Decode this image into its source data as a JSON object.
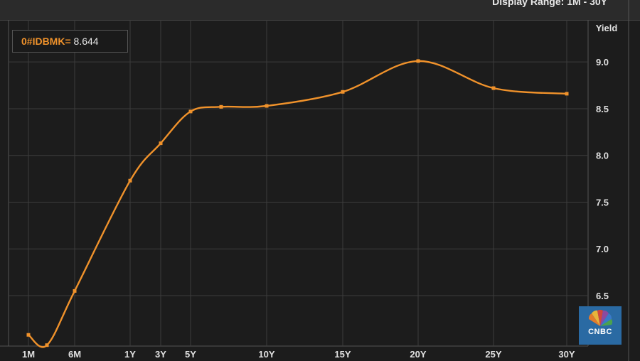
{
  "header": {
    "display_range": "Display Range: 1M - 30Y"
  },
  "legend": {
    "series_label": "0#IDBMK=",
    "current_value": "8.644"
  },
  "logo": {
    "text": "CNBC"
  },
  "colors": {
    "series": "#f0922b",
    "background": "#1c1c1c",
    "grid": "#3c3c3c"
  },
  "chart_data": {
    "type": "line",
    "title": "",
    "xlabel": "",
    "ylabel": "Yield",
    "x_ticks": [
      "1M",
      "6M",
      "1Y",
      "3Y",
      "5Y",
      "10Y",
      "15Y",
      "20Y",
      "25Y",
      "30Y"
    ],
    "y_ticks": [
      "6.5",
      "7.0",
      "7.5",
      "8.0",
      "8.5",
      "9.0"
    ],
    "ylim": [
      5.96,
      9.45
    ],
    "grid": true,
    "legend_position": "top-left",
    "series": [
      {
        "name": "0#IDBMK=",
        "x": [
          "1M",
          "3M",
          "6M",
          "1Y",
          "3Y",
          "5Y",
          "7Y",
          "10Y",
          "15Y",
          "20Y",
          "25Y",
          "30Y"
        ],
        "values": [
          6.08,
          5.97,
          6.55,
          7.73,
          8.13,
          8.47,
          8.52,
          8.53,
          8.68,
          9.01,
          8.72,
          8.66
        ]
      }
    ]
  }
}
